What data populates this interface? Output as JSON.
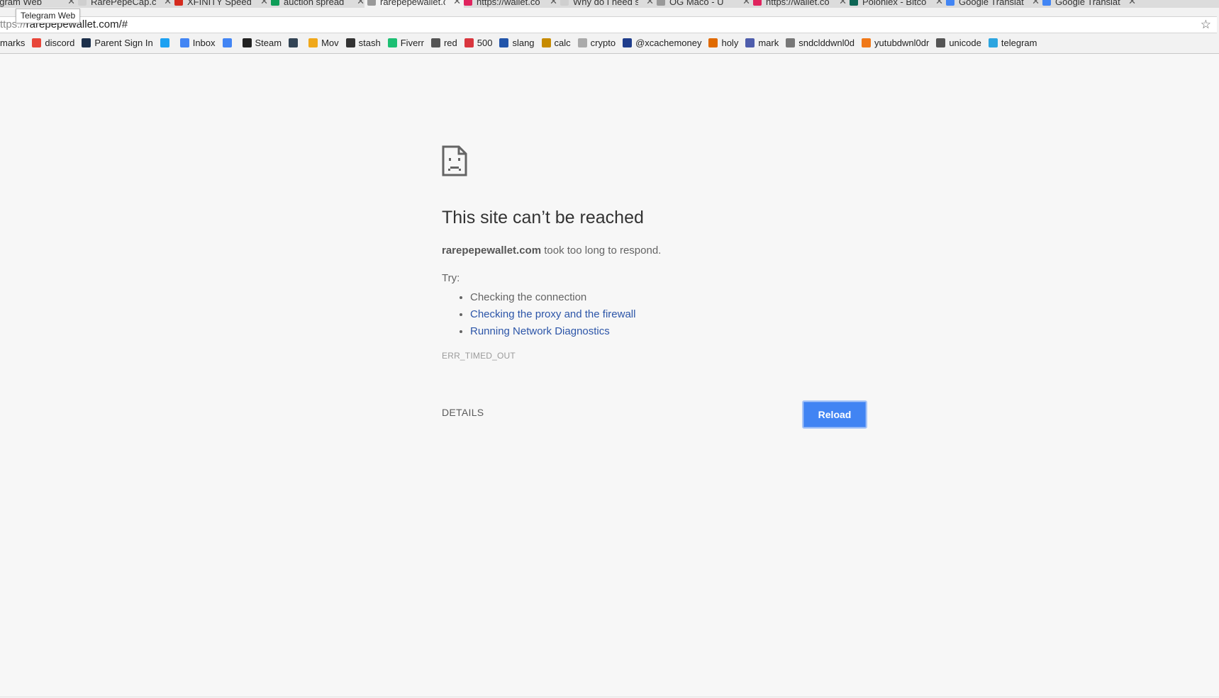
{
  "browser": {
    "tabs": [
      {
        "title": "egram Web",
        "favicon_color": "#2ca5e0",
        "active": false
      },
      {
        "title": "RarePepeCap.com",
        "favicon_color": "#cfcfcf",
        "active": false
      },
      {
        "title": "XFINITY Speed",
        "favicon_color": "#d52b1e",
        "active": false
      },
      {
        "title": "auction spread",
        "favicon_color": "#0f9d58",
        "active": false
      },
      {
        "title": "rarepepewallet.c",
        "favicon_color": "#999999",
        "active": true
      },
      {
        "title": "https://wallet.co",
        "favicon_color": "#e0245e",
        "active": false
      },
      {
        "title": "Why do I need s",
        "favicon_color": "#cfcfcf",
        "active": false
      },
      {
        "title": "OG Maco - U",
        "favicon_color": "#999999",
        "active": false
      },
      {
        "title": "https://wallet.co",
        "favicon_color": "#e0245e",
        "active": false
      },
      {
        "title": "Poloniex - Bitco",
        "favicon_color": "#0e6655",
        "active": false
      },
      {
        "title": "Google Translate",
        "favicon_color": "#4285f4",
        "active": false
      },
      {
        "title": "Google Translate",
        "favicon_color": "#4285f4",
        "active": false
      }
    ],
    "tab_close_glyph": "✕",
    "tooltip": "Telegram Web",
    "address": {
      "scheme": "ttps://",
      "host": "rarepepewallet.com/#"
    },
    "star_glyph": "☆"
  },
  "bookmarks": [
    {
      "label": "marks",
      "icon": "none",
      "color": ""
    },
    {
      "label": "discord",
      "icon": "discord-icon",
      "color": "#e8463a"
    },
    {
      "label": "Parent Sign In",
      "icon": "parent-portal-icon",
      "color": "#1c2f4a"
    },
    {
      "label": "",
      "icon": "twitter-icon",
      "color": "#1da1f2"
    },
    {
      "label": "Inbox",
      "icon": "inbox-icon",
      "color": "#4285f4"
    },
    {
      "label": "",
      "icon": "translate-icon",
      "color": "#4285f4"
    },
    {
      "label": "Steam",
      "icon": "steam-icon",
      "color": "#222222"
    },
    {
      "label": "",
      "icon": "x-logo-icon",
      "color": "#334455"
    },
    {
      "label": "Mov",
      "icon": "coin-icon",
      "color": "#f0a81a"
    },
    {
      "label": "stash",
      "icon": "box-icon",
      "color": "#333333"
    },
    {
      "label": "Fiverr",
      "icon": "fiverr-icon",
      "color": "#1dbf73"
    },
    {
      "label": "red",
      "icon": "reddit-icon",
      "color": "#555555"
    },
    {
      "label": "500",
      "icon": "circle-icon",
      "color": "#d9363e"
    },
    {
      "label": "slang",
      "icon": "grid-icon",
      "color": "#2255aa"
    },
    {
      "label": "calc",
      "icon": "bitcoin-icon",
      "color": "#c78b00"
    },
    {
      "label": "crypto",
      "icon": "coin-stack-icon",
      "color": "#aaaaaa"
    },
    {
      "label": "@xcachemoney",
      "icon": "slash-logo-icon",
      "color": "#1f3d8c"
    },
    {
      "label": "holy",
      "icon": "ticket-icon",
      "color": "#e06a00"
    },
    {
      "label": "mark",
      "icon": "discord-icon",
      "color": "#4e5dac"
    },
    {
      "label": "sndclddwnl0d",
      "icon": "page-icon",
      "color": "#777777"
    },
    {
      "label": "yutubdwnl0dr",
      "icon": "spark-icon",
      "color": "#f07818"
    },
    {
      "label": "unicode",
      "icon": "reddit-icon",
      "color": "#555555"
    },
    {
      "label": "telegram",
      "icon": "telegram-icon",
      "color": "#2ca5e0"
    }
  ],
  "error": {
    "title": "This site can’t be reached",
    "host": "rarepepewallet.com",
    "desc_suffix": " took too long to respond.",
    "try_label": "Try:",
    "suggestions": [
      {
        "text": "Checking the connection",
        "link": false
      },
      {
        "text": "Checking the proxy and the firewall",
        "link": true
      },
      {
        "text": "Running Network Diagnostics",
        "link": true
      }
    ],
    "code": "ERR_TIMED_OUT",
    "details_label": "DETAILS",
    "reload_label": "Reload"
  }
}
